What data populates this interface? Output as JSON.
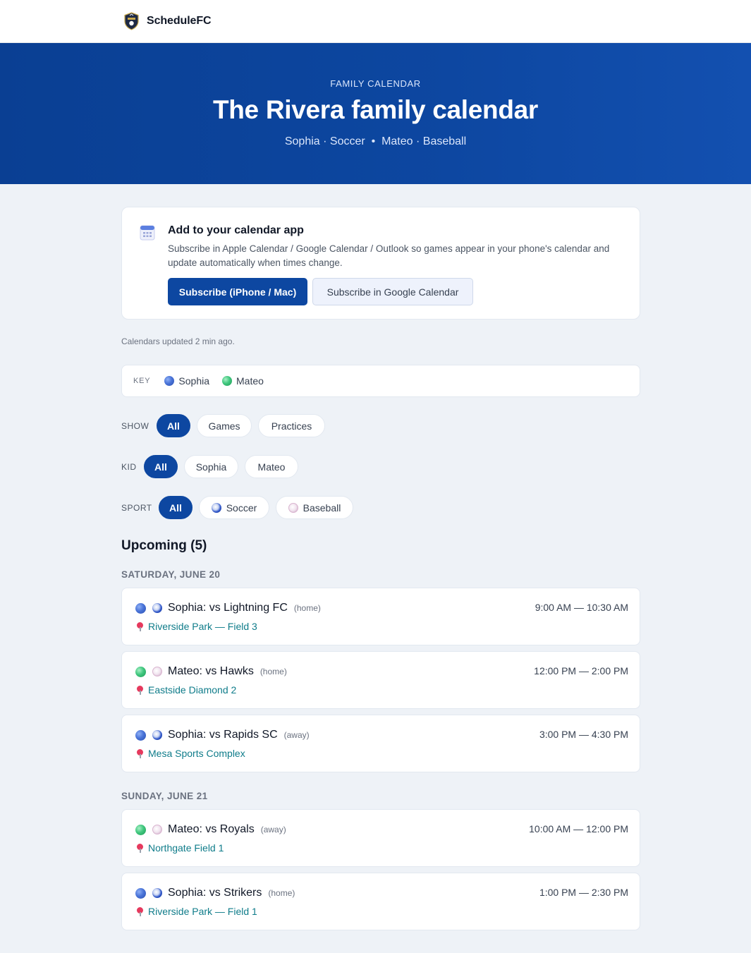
{
  "brand": {
    "name": "ScheduleFC"
  },
  "hero": {
    "eyebrow": "FAMILY CALENDAR",
    "title": "The Rivera family calendar",
    "subtitle": "Sophia · Soccer  •  Mateo · Baseball"
  },
  "calendar_card": {
    "title": "Add to your calendar app",
    "description": "Subscribe in Apple Calendar / Google Calendar / Outlook so games appear in your phone's calendar and update automatically when times change.",
    "primary_button": "Subscribe (iPhone / Mac)",
    "secondary_button": "Subscribe in Google Calendar"
  },
  "updated_text": "Calendars updated 2 min ago.",
  "key": {
    "label": "KEY",
    "items": [
      {
        "name": "Sophia",
        "color": "#3b64d0"
      },
      {
        "name": "Mateo",
        "color": "#2fbf6f"
      }
    ]
  },
  "filters": {
    "show": {
      "label": "SHOW",
      "options": [
        "All",
        "Games",
        "Practices"
      ],
      "selected": "All"
    },
    "kid": {
      "label": "KID",
      "options": [
        "All",
        "Sophia",
        "Mateo"
      ],
      "selected": "All"
    },
    "sport": {
      "label": "SPORT",
      "options": [
        "All",
        "Soccer",
        "Baseball"
      ],
      "selected": "All"
    }
  },
  "upcoming": {
    "heading": "Upcoming (5)"
  },
  "days": [
    {
      "label": "SATURDAY, JUNE 20",
      "events": [
        {
          "title": "Sophia: vs Lightning FC",
          "venue_tag": "(home)",
          "location": "Riverside Park — Field 3",
          "time": "9:00 AM — 10:30 AM",
          "kid": "Sophia",
          "sport": "soccer"
        },
        {
          "title": "Mateo: vs Hawks",
          "venue_tag": "(home)",
          "location": "Eastside Diamond 2",
          "time": "12:00 PM — 2:00 PM",
          "kid": "Mateo",
          "sport": "baseball"
        },
        {
          "title": "Sophia: vs Rapids SC",
          "venue_tag": "(away)",
          "location": "Mesa Sports Complex",
          "time": "3:00 PM — 4:30 PM",
          "kid": "Sophia",
          "sport": "soccer"
        }
      ]
    },
    {
      "label": "SUNDAY, JUNE 21",
      "events": [
        {
          "title": "Mateo: vs Royals",
          "venue_tag": "(away)",
          "location": "Northgate Field 1",
          "time": "10:00 AM — 12:00 PM",
          "kid": "Mateo",
          "sport": "baseball"
        },
        {
          "title": "Sophia: vs Strikers",
          "venue_tag": "(home)",
          "location": "Riverside Park — Field 1",
          "time": "1:00 PM — 2:30 PM",
          "kid": "Sophia",
          "sport": "soccer"
        }
      ]
    }
  ],
  "colors": {
    "brand": "#0d47a1",
    "location": "#0f7c8a",
    "pin": "#e6395d"
  }
}
